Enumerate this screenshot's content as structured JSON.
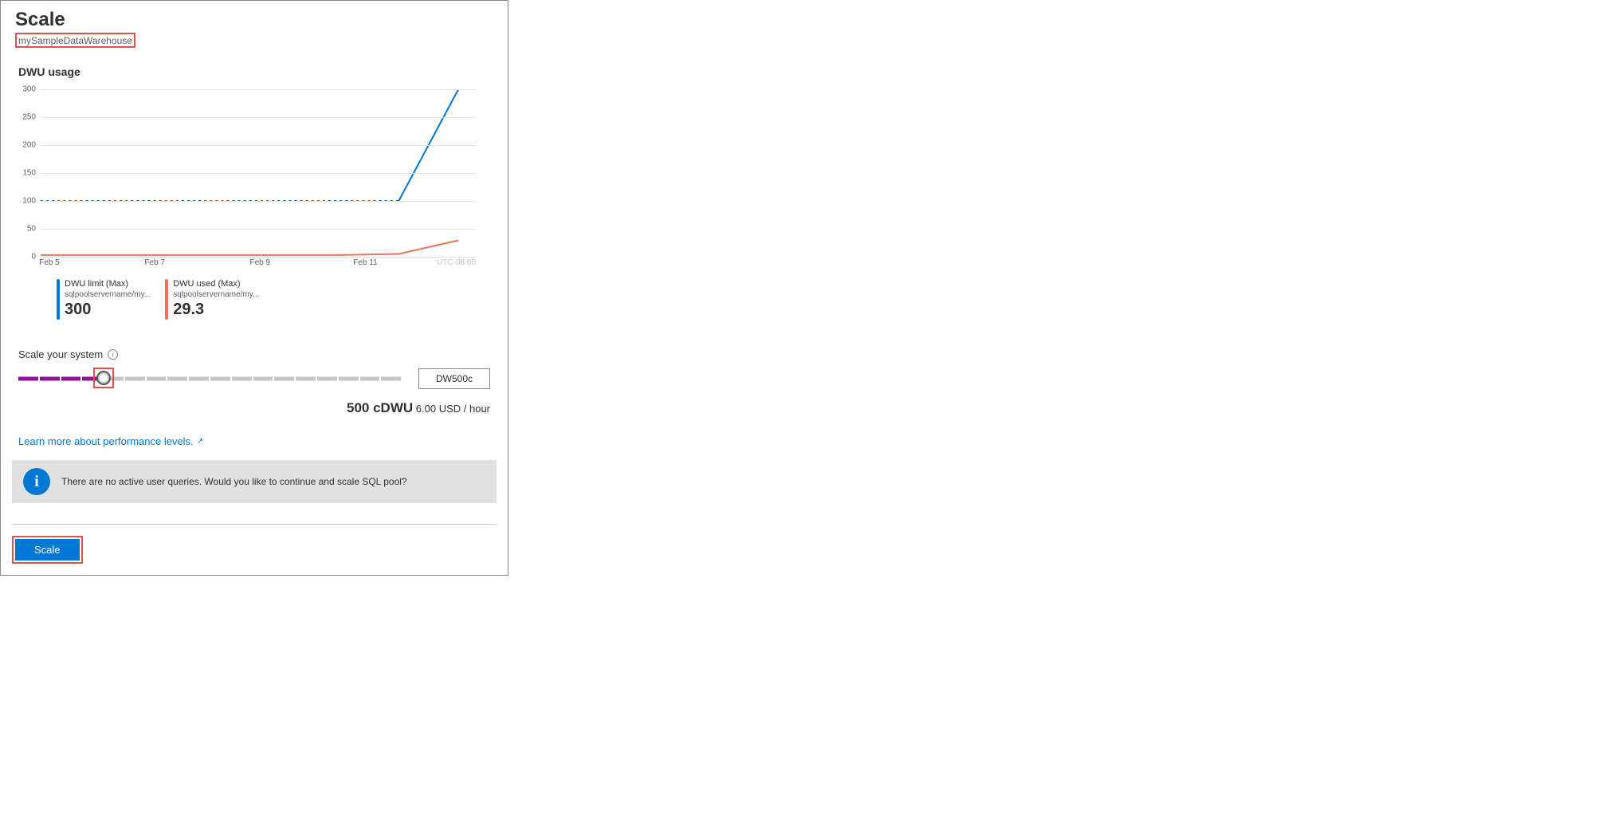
{
  "header": {
    "title": "Scale",
    "subtitle": "mySampleDataWarehouse"
  },
  "chart_section_title": "DWU usage",
  "chart_data": {
    "type": "line",
    "ylim": [
      0,
      300
    ],
    "y_ticks": [
      0,
      50,
      100,
      150,
      200,
      250,
      300
    ],
    "x_categories": [
      "Feb 5",
      "Feb 7",
      "Feb 9",
      "Feb 11"
    ],
    "timezone_label": "UTC-08:00",
    "series": [
      {
        "name": "DWU limit (Max)",
        "sub": "sqlpoolservername/my...",
        "color": "#0078d4",
        "style_pre": "dashed",
        "style_post": "solid",
        "display_value": "300",
        "values": [
          100,
          100,
          100,
          100,
          100,
          100,
          100,
          300
        ]
      },
      {
        "name": "DWU used (Max)",
        "sub": "sqlpoolservername/my...",
        "color": "#e8735a",
        "style_pre": "solid",
        "style_post": "solid",
        "display_value": "29.3",
        "values": [
          3,
          3,
          3,
          3,
          3,
          3,
          5,
          29.3
        ]
      }
    ]
  },
  "scale": {
    "label": "Scale your system",
    "total_segments": 18,
    "filled_segments": 4,
    "selected_value": "DW500c"
  },
  "price": {
    "big": "500 cDWU",
    "small": "6.00 USD / hour"
  },
  "learn_more": "Learn more about performance levels.",
  "info_message": "There are no active user queries. Would you like to continue and scale SQL pool?",
  "action_button": "Scale"
}
